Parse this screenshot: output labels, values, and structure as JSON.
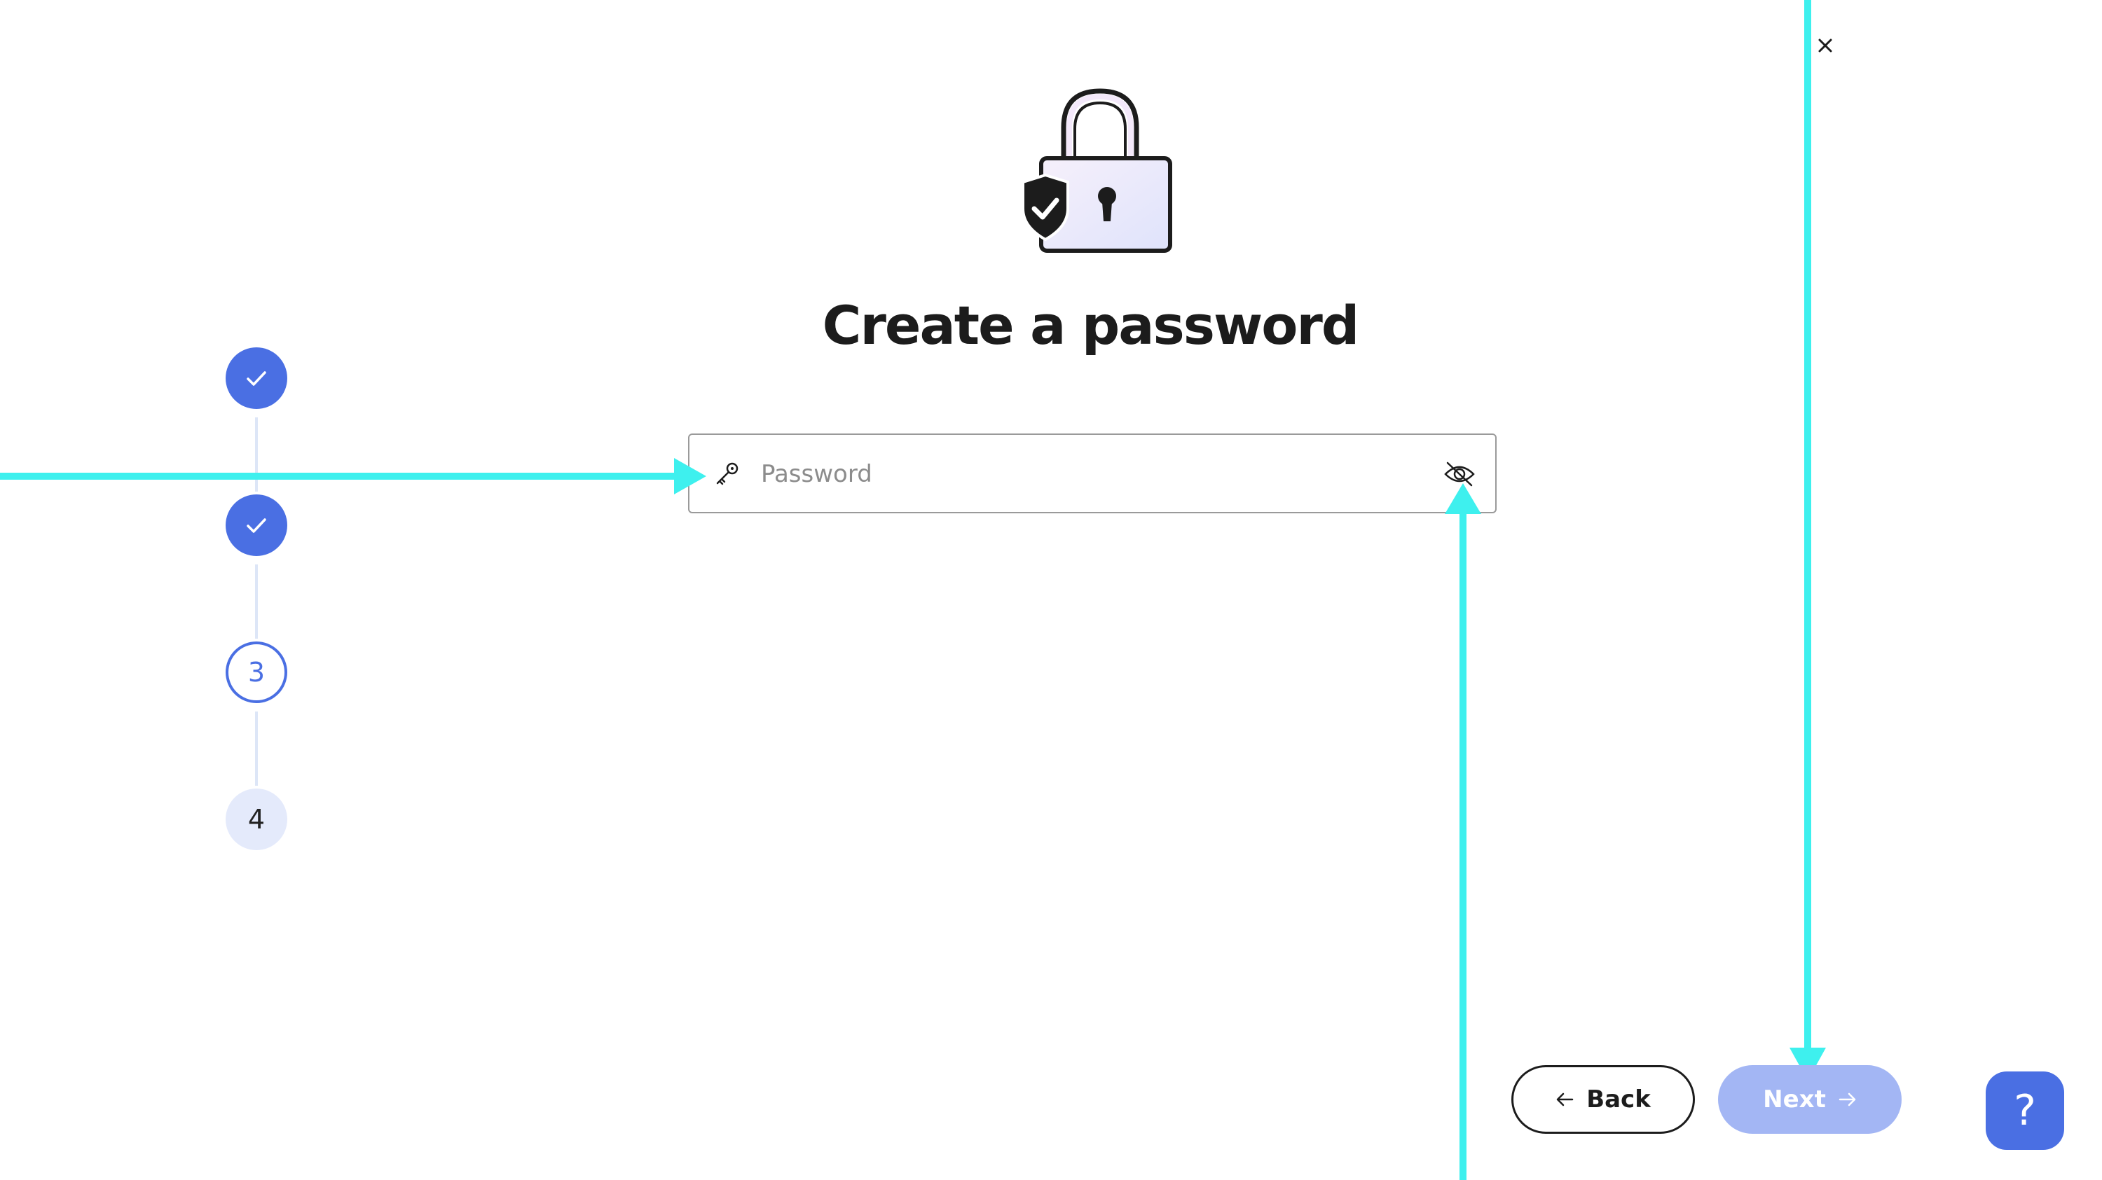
{
  "page": {
    "title": "Create a password"
  },
  "stepper": {
    "steps": [
      {
        "status": "completed",
        "label": ""
      },
      {
        "status": "completed",
        "label": ""
      },
      {
        "status": "current",
        "label": "3"
      },
      {
        "status": "pending",
        "label": "4"
      }
    ]
  },
  "password_field": {
    "placeholder": "Password",
    "value": "",
    "leading_icon": "key-icon",
    "trailing_icon": "eye-off-icon"
  },
  "footer": {
    "back_label": "Back",
    "next_label": "Next"
  },
  "help": {
    "label": "?"
  },
  "colors": {
    "accent": "#4a6fe3",
    "next_disabled": "#a3b6f4",
    "annotation_arrow": "#3ef0ee",
    "step_pending_bg": "#e4eafb"
  }
}
